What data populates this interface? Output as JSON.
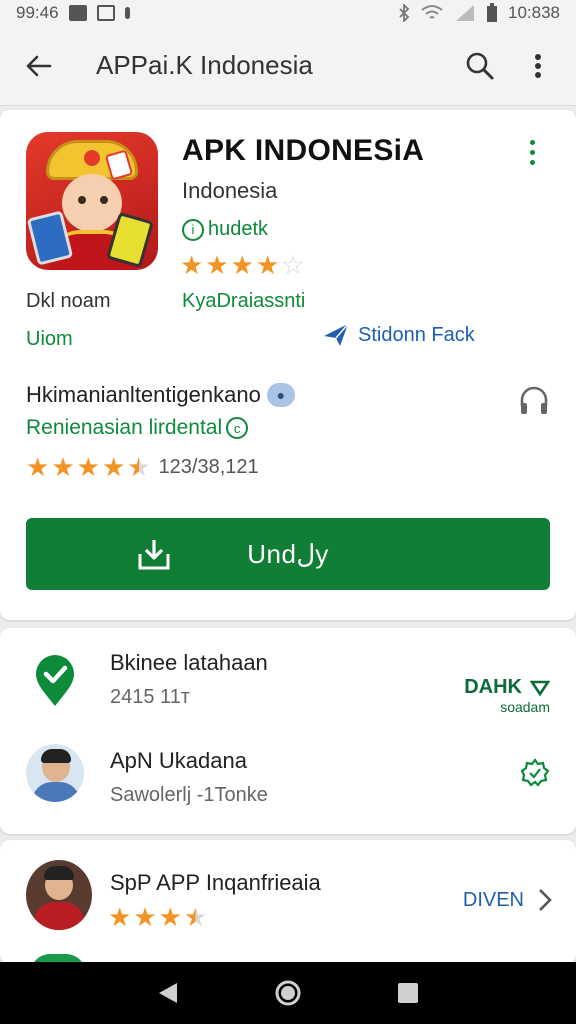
{
  "status_bar": {
    "time": "99:46",
    "clock": "10:838"
  },
  "app_bar": {
    "title": "APPai.K Indonesia"
  },
  "app": {
    "name": "APK INDONESiA",
    "developer": "Indonesia",
    "tag": "hudetk",
    "rating_stars": 4,
    "meta_left": "Dkl noam",
    "meta_right": "KyaDraiassnti",
    "meta_left2": "Uiom",
    "meta_right2": "Stidonn Fack"
  },
  "info": {
    "title": "Hkimanianltentigenkano",
    "subtitle": "Renienasian lirdental",
    "rating_stars": 4.5,
    "rating_count": "123/38,121"
  },
  "install": {
    "label": "Undلy"
  },
  "list": [
    {
      "title": "Bkinee latahaan",
      "subtitle": "2415 11т",
      "action": "DAHK",
      "action_sub": "soadam"
    },
    {
      "title": "ApN Ukadana",
      "subtitle": "Sawolerlj -1Tonke"
    }
  ],
  "suggest": {
    "title": "SpP APP Inqanfrieaia",
    "rating_stars": 3.5,
    "action": "DIVEN"
  },
  "colors": {
    "primary_green": "#107e35",
    "accent_blue": "#1f5fae",
    "star_orange": "#f29324"
  }
}
